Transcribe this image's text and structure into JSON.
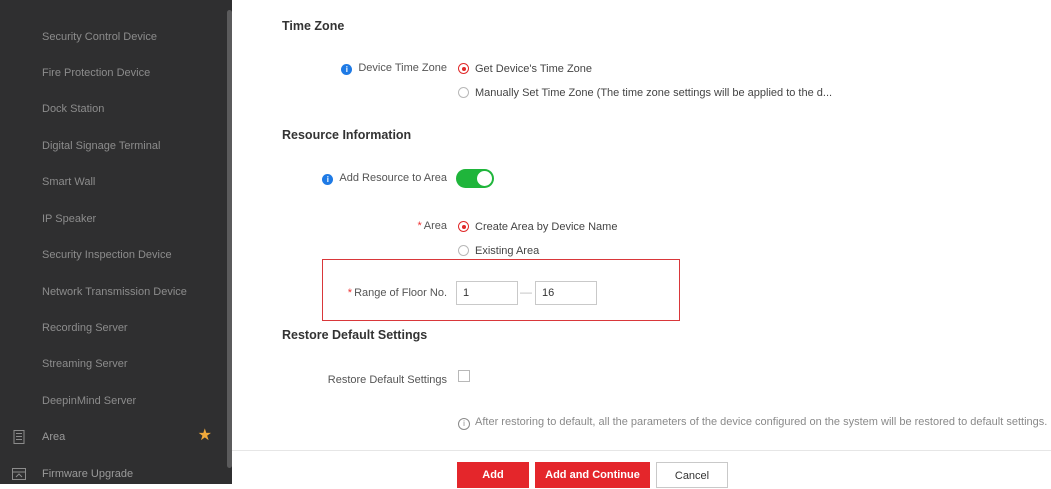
{
  "sidebar": {
    "items": [
      {
        "label": "Security Control Device"
      },
      {
        "label": "Fire Protection Device"
      },
      {
        "label": "Dock Station"
      },
      {
        "label": "Digital Signage Terminal"
      },
      {
        "label": "Smart Wall"
      },
      {
        "label": "IP Speaker"
      },
      {
        "label": "Security Inspection Device"
      },
      {
        "label": "Network Transmission Device"
      },
      {
        "label": "Recording Server"
      },
      {
        "label": "Streaming Server"
      },
      {
        "label": "DeepinMind Server"
      }
    ],
    "main_items": [
      {
        "label": "Area",
        "icon": "area-icon",
        "starred": true
      },
      {
        "label": "Firmware Upgrade",
        "icon": "firmware-upgrade-icon"
      }
    ],
    "star_color": "#f0a93b"
  },
  "time_zone": {
    "section_title": "Time Zone",
    "label": "Device Time Zone",
    "options": [
      {
        "label": "Get Device's Time Zone",
        "selected": true
      },
      {
        "label": "Manually Set Time Zone (The time zone settings will be applied to the d...",
        "selected": false
      }
    ]
  },
  "resource": {
    "section_title": "Resource Information",
    "add_to_area_label": "Add Resource to Area",
    "add_to_area_enabled": true,
    "area_label": "Area",
    "area_options": [
      {
        "label": "Create Area by Device Name",
        "selected": true
      },
      {
        "label": "Existing Area",
        "selected": false
      }
    ],
    "floor_label": "Range of Floor No.",
    "floor_from": "1",
    "floor_to": "16",
    "floor_separator": "—"
  },
  "restore": {
    "section_title": "Restore Default Settings",
    "label": "Restore Default Settings",
    "checked": false,
    "hint": "After restoring to default, all the parameters of the device configured on the system will be restored to default settings."
  },
  "footer": {
    "add": "Add",
    "add_continue": "Add and Continue",
    "cancel": "Cancel"
  },
  "colors": {
    "accent_red": "#e4262b",
    "toggle_green": "#1fb53b",
    "info_blue": "#1e7ae5",
    "sidebar_bg": "#2f2f30"
  }
}
